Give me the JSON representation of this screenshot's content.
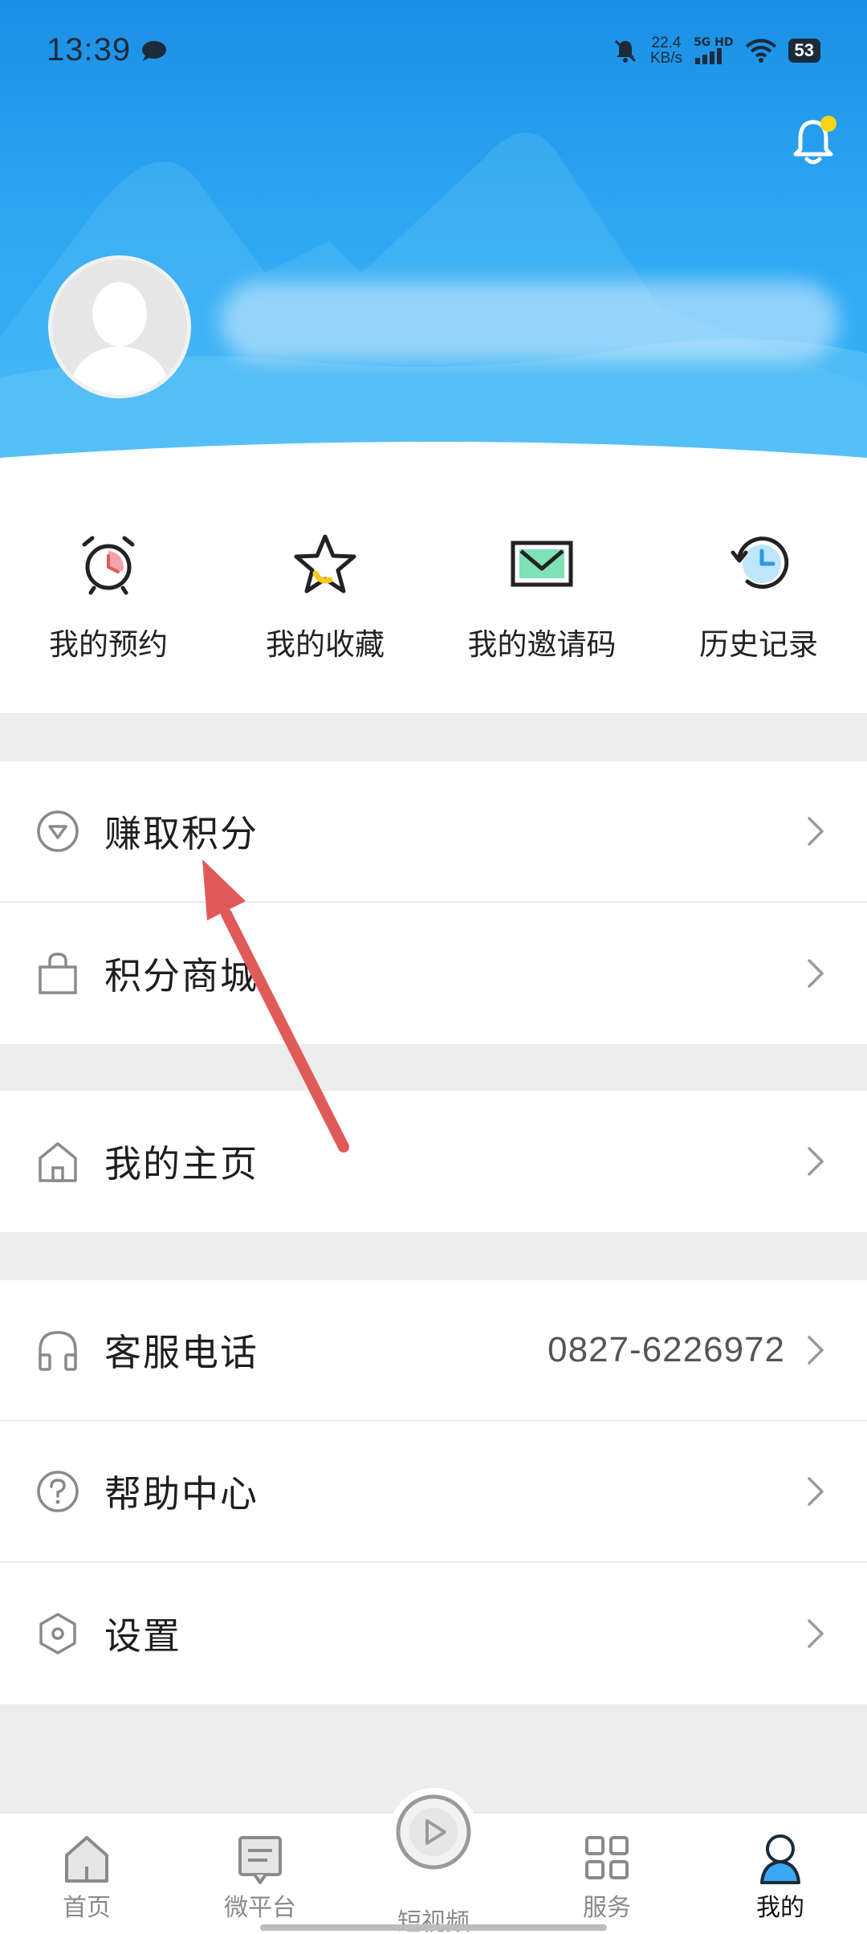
{
  "status_bar": {
    "time": "13:39",
    "net_speed_value": "22.4",
    "net_speed_unit": "KB/s",
    "signal_label": "5G HD",
    "battery": "53"
  },
  "quick_actions": [
    {
      "label": "我的预约",
      "icon": "alarm-clock-icon"
    },
    {
      "label": "我的收藏",
      "icon": "star-icon"
    },
    {
      "label": "我的邀请码",
      "icon": "envelope-icon"
    },
    {
      "label": "历史记录",
      "icon": "history-clock-icon"
    }
  ],
  "menu": {
    "earn_points": {
      "label": "赚取积分",
      "icon": "diamond-icon"
    },
    "points_mall": {
      "label": "积分商城",
      "icon": "shopping-bag-icon"
    },
    "my_homepage": {
      "label": "我的主页",
      "icon": "house-icon"
    },
    "customer_service": {
      "label": "客服电话",
      "value": "0827-6226972",
      "icon": "headphones-icon"
    },
    "help_center": {
      "label": "帮助中心",
      "icon": "question-icon"
    },
    "settings": {
      "label": "设置",
      "icon": "hexagon-gear-icon"
    }
  },
  "tabbar": [
    {
      "label": "首页",
      "icon": "home-icon"
    },
    {
      "label": "微平台",
      "icon": "message-board-icon"
    },
    {
      "label": "短视频",
      "icon": "play-icon"
    },
    {
      "label": "服务",
      "icon": "grid-icon"
    },
    {
      "label": "我的",
      "icon": "profile-icon",
      "active": true
    }
  ],
  "colors": {
    "header_blue": "#2ea6f2",
    "accent_red": "#e05a5a",
    "bell_dot": "#f7d417",
    "icon_gray": "#8a8a8a"
  }
}
